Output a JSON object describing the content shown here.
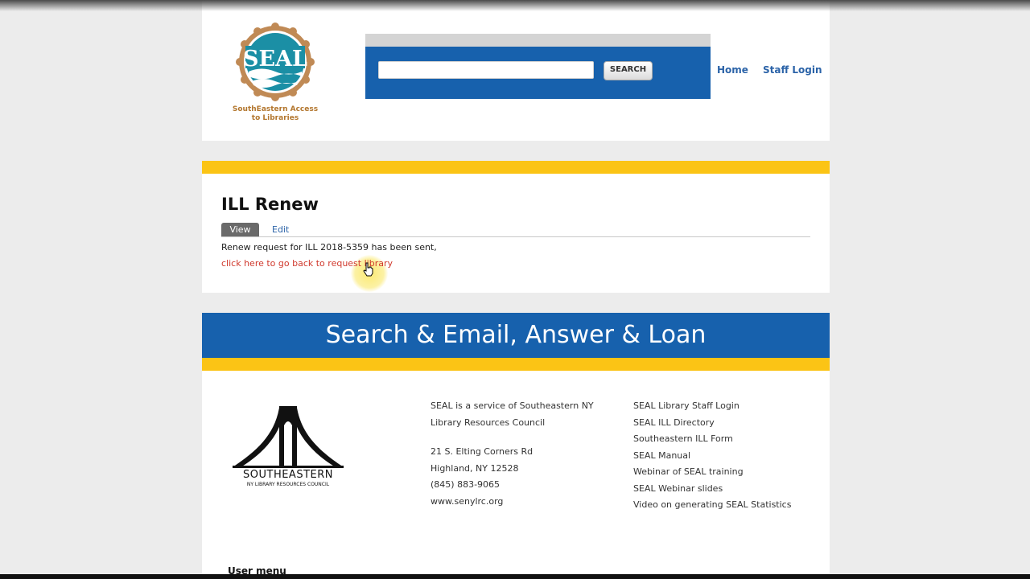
{
  "header": {
    "logo_text": "SEAL",
    "logo_caption_line1": "SouthEastern Access",
    "logo_caption_line2": "to Libraries",
    "search": {
      "value": "",
      "placeholder": "",
      "button_label": "SEARCH"
    },
    "nav": {
      "home": "Home",
      "staff_login": "Staff Login"
    }
  },
  "content": {
    "title": "ILL Renew",
    "tabs": {
      "view": "View",
      "edit": "Edit"
    },
    "message": "Renew request for ILL 2018-5359 has been sent,",
    "back_link": "click here to go back to request library"
  },
  "banner": {
    "text": "Search & Email, Answer & Loan"
  },
  "footer": {
    "org_logo": {
      "name": "SOUTHEASTERN",
      "sub": "NY LIBRARY RESOURCES COUNCIL"
    },
    "about": {
      "line1": "SEAL is a service of Southeastern NY",
      "line2": "Library Resources Council",
      "address1": "21 S. Elting Corners Rd",
      "address2": "Highland, NY 12528",
      "phone": "(845) 883-9065",
      "website": "www.senylrc.org"
    },
    "links": [
      "SEAL Library Staff Login",
      "SEAL ILL Directory",
      "Southeastern ILL Form",
      "SEAL Manual",
      "Webinar of SEAL training",
      "SEAL Webinar slides",
      "Video on generating SEAL Statistics"
    ],
    "user_menu": "User menu"
  },
  "colors": {
    "brand_blue": "#1761ad",
    "accent_yellow": "#fbc415",
    "link_blue": "#2b63a8",
    "link_red": "#d0392d",
    "seal_teal": "#1b8fa5",
    "seal_bronze": "#c08a55"
  }
}
